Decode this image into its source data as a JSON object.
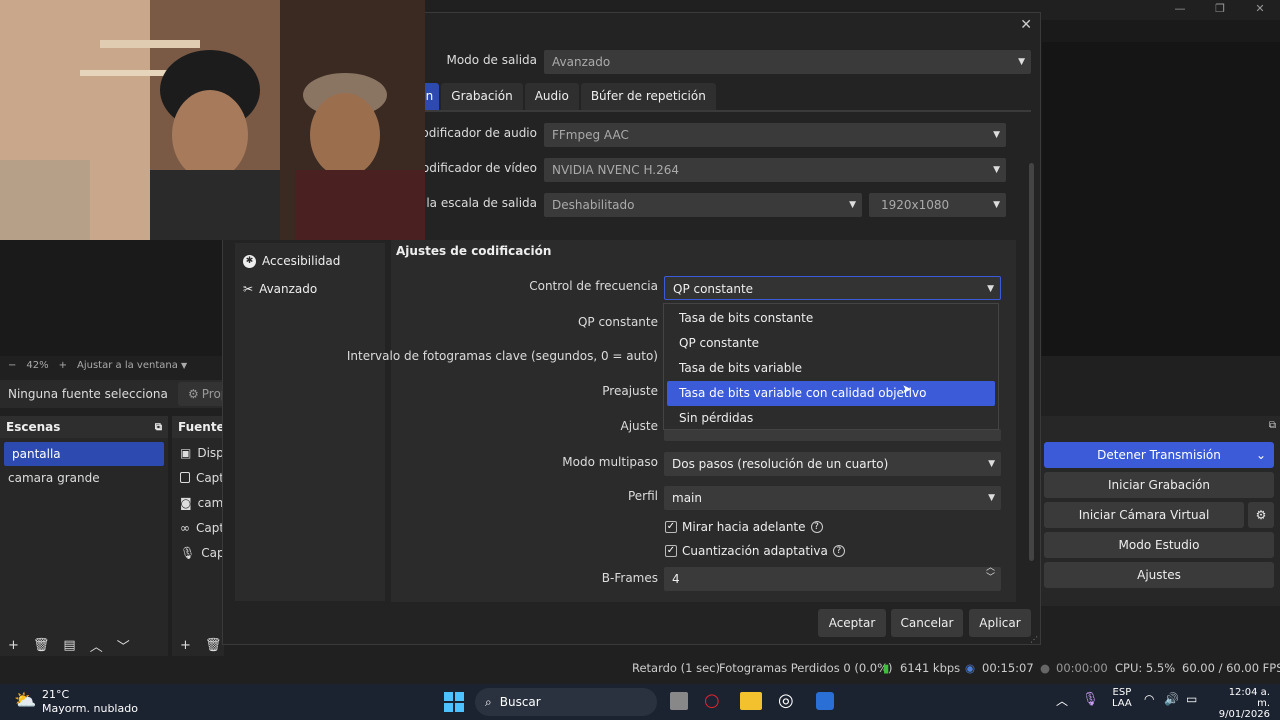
{
  "obs": {
    "zoom_minus": "−",
    "zoom_value": "42%",
    "zoom_plus": "+",
    "zoom_fit": "Ajustar a la ventana",
    "no_source": "Ninguna fuente selecciona",
    "props_label": "Prop",
    "scenes": {
      "title": "Escenas",
      "items": [
        "pantalla",
        "camara grande"
      ]
    },
    "sources": {
      "title": "Fuentes",
      "items": [
        "Dispo",
        "Capt",
        "cama",
        "Capt",
        "Capt"
      ]
    },
    "controls": {
      "stop_stream": "Detener Transmisión",
      "start_recording": "Iniciar Grabación",
      "start_virtual_cam": "Iniciar Cámara Virtual",
      "studio_mode": "Modo Estudio",
      "settings": "Ajustes"
    },
    "status": {
      "delay": "Retardo (1 sec)",
      "dropped": "Fotogramas Perdidos 0 (0.0%)",
      "kbps": "6141 kbps",
      "stream_time": "00:15:07",
      "rec_time": "00:00:00",
      "cpu": "CPU: 5.5%",
      "fps": "60.00 / 60.00 FPS"
    }
  },
  "dialog": {
    "output_mode_label": "Modo de salida",
    "output_mode_value": "Avanzado",
    "tabs": [
      "ión",
      "Grabación",
      "Audio",
      "Búfer de repetición"
    ],
    "audio_encoder_label": "Codificador de audio",
    "audio_encoder_value": "FFmpeg AAC",
    "video_encoder_label": "Codificador de vídeo",
    "video_encoder_value": "NVIDIA NVENC H.264",
    "rescale_label": "biar la escala de salida",
    "rescale_value": "Deshabilitado",
    "rescale_res": "1920x1080",
    "menu": [
      {
        "icon": "accessibility-icon",
        "label": "Accesibilidad"
      },
      {
        "icon": "tools-icon",
        "label": "Avanzado"
      }
    ],
    "section_title": "Ajustes de codificación",
    "rate_control_label": "Control de frecuencia",
    "rate_control_value": "QP constante",
    "cqp_label": "QP constante",
    "keyframe_label": "Intervalo de fotogramas clave (segundos, 0 = auto)",
    "preset_label": "Preajuste",
    "tune_label": "Ajuste",
    "multipass_label": "Modo multipaso",
    "multipass_value": "Dos pasos (resolución de un cuarto)",
    "profile_label": "Perfil",
    "profile_value": "main",
    "lookahead_label": "Mirar hacia adelante",
    "adaptive_quant_label": "Cuantización adaptativa",
    "bframes_label": "B-Frames",
    "bframes_value": "4",
    "dropdown_options": [
      "Tasa de bits constante",
      "QP constante",
      "Tasa de bits variable",
      "Tasa de bits variable con calidad objetivo",
      "Sin pérdidas"
    ],
    "highlighted_option_index": 3,
    "ok_button": "Aceptar",
    "cancel_button": "Cancelar",
    "apply_button": "Aplicar"
  },
  "taskbar": {
    "weather_temp": "21°C",
    "weather_desc": "Mayorm. nublado",
    "search_placeholder": "Buscar",
    "lang_top": "ESP",
    "lang_bottom": "LAA",
    "time": "12:04 a. m.",
    "date": "9/01/2026"
  },
  "colors": {
    "accent": "#3b5bd8",
    "selection": "#2c4aaf",
    "stream_green": "#3fbf3f"
  }
}
